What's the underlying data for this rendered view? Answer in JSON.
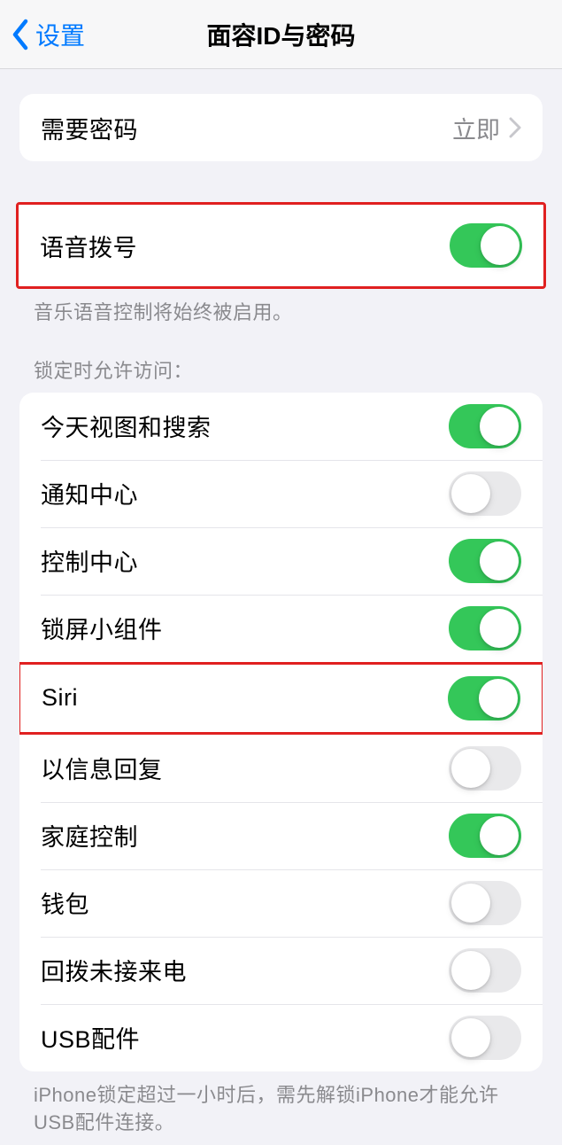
{
  "nav": {
    "back_label": "设置",
    "title": "面容ID与密码"
  },
  "require_passcode": {
    "label": "需要密码",
    "value": "立即"
  },
  "voice_dial": {
    "label": "语音拨号",
    "on": true,
    "footer": "音乐语音控制将始终被启用。"
  },
  "lock_access_header": "锁定时允许访问：",
  "lock_access": {
    "items": [
      {
        "label": "今天视图和搜索",
        "on": true
      },
      {
        "label": "通知中心",
        "on": false
      },
      {
        "label": "控制中心",
        "on": true
      },
      {
        "label": "锁屏小组件",
        "on": true
      },
      {
        "label": "Siri",
        "on": true
      },
      {
        "label": "以信息回复",
        "on": false
      },
      {
        "label": "家庭控制",
        "on": true
      },
      {
        "label": "钱包",
        "on": false
      },
      {
        "label": "回拨未接来电",
        "on": false
      },
      {
        "label": "USB配件",
        "on": false
      }
    ]
  },
  "usb_footer": "iPhone锁定超过一小时后，需先解锁iPhone才能允许USB配件连接。"
}
